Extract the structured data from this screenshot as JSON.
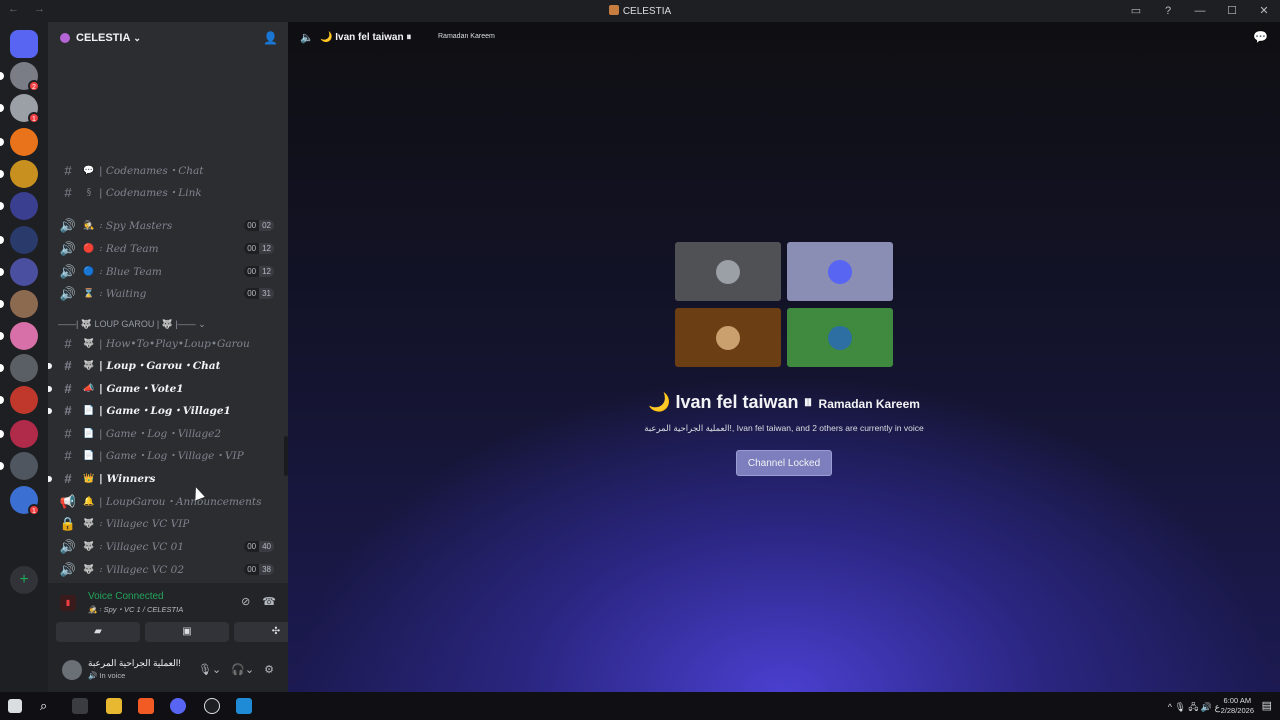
{
  "window": {
    "title": "CELESTIA",
    "controls": [
      "inbox-icon",
      "help-icon",
      "minimize-icon",
      "maximize-icon",
      "close-icon"
    ]
  },
  "guilds": {
    "items": [
      {
        "name": "discord-home",
        "color": "#5865f2"
      },
      {
        "name": "server-1",
        "color": "#7a7d85",
        "badge": "2"
      },
      {
        "name": "server-2",
        "color": "#9aa0a6",
        "badge": "1"
      },
      {
        "name": "server-3",
        "color": "#e8731a"
      },
      {
        "name": "server-4",
        "color": "#c7901f"
      },
      {
        "name": "server-5",
        "color": "#3b3f8f"
      },
      {
        "name": "server-6",
        "color": "#2a3a6a"
      },
      {
        "name": "server-7",
        "color": "#4a4f9f"
      },
      {
        "name": "server-8",
        "color": "#8c6a4f"
      },
      {
        "name": "server-9",
        "color": "#d76fa8"
      },
      {
        "name": "server-10",
        "color": "#5a5f66"
      },
      {
        "name": "server-11",
        "color": "#c0382b"
      },
      {
        "name": "server-12",
        "color": "#b02a4a"
      },
      {
        "name": "server-13",
        "color": "#4f5660"
      },
      {
        "name": "server-14",
        "color": "#3b6fd1",
        "badge": "1"
      }
    ],
    "add_label": "+"
  },
  "server": {
    "name": "CELESTIA"
  },
  "channels": [
    {
      "type": "text",
      "emoji": "💬",
      "name": "Codenames・Chat",
      "bold": false
    },
    {
      "type": "text",
      "emoji": "§",
      "name": "Codenames・Link",
      "bold": false
    },
    {
      "type": "voice",
      "emoji": "🕵",
      "name": "Spy Masters",
      "counts": [
        "00",
        "02"
      ]
    },
    {
      "type": "voice",
      "emoji": "🔴",
      "name": "Red Team",
      "counts": [
        "00",
        "12"
      ]
    },
    {
      "type": "voice",
      "emoji": "🔵",
      "name": "Blue Team",
      "counts": [
        "00",
        "12"
      ]
    },
    {
      "type": "voice",
      "emoji": "⌛",
      "name": "Waiting",
      "counts": [
        "00",
        "31"
      ]
    },
    {
      "type": "text",
      "emoji": "🐺",
      "name": "How•To•Play•Loup•Garou",
      "bold": false
    },
    {
      "type": "text",
      "emoji": "🐺",
      "name": "Loup・Garou・Chat",
      "bold": true,
      "unread": true
    },
    {
      "type": "text",
      "emoji": "📣",
      "name": "Game・Vote1",
      "bold": true,
      "unread": true
    },
    {
      "type": "text",
      "emoji": "📄",
      "name": "Game・Log・Village1",
      "bold": true,
      "unread": true
    },
    {
      "type": "text",
      "emoji": "📄",
      "name": "Game・Log・Village2",
      "bold": false
    },
    {
      "type": "text",
      "emoji": "📄",
      "name": "Game・Log・Village・VIP",
      "bold": false
    },
    {
      "type": "text",
      "emoji": "👑",
      "name": "Winners",
      "bold": true,
      "unread": true
    },
    {
      "type": "announce",
      "emoji": "🔔",
      "name": "LoupGarou・Announcements",
      "bold": false
    },
    {
      "type": "locked",
      "emoji": "🐺",
      "name": "Villagec VC VIP"
    },
    {
      "type": "voice",
      "emoji": "🐺",
      "name": "Villagec VC 01",
      "counts": [
        "00",
        "40"
      ]
    },
    {
      "type": "voice",
      "emoji": "🐺",
      "name": "Villagec VC 02",
      "counts": [
        "00",
        "38"
      ]
    }
  ],
  "category": {
    "label": "——| 🐺 LOUP GAROU | 🐺 |——"
  },
  "voice_panel": {
    "status": "Voice Connected",
    "channel": "🕵 ꞉ Spy・VC 1 / CELESTIA"
  },
  "user": {
    "name": "العملية الجراحية المرعبة!",
    "status": "In voice"
  },
  "voice_channel": {
    "name": "🌙 Ivan fel taiwan ⏸",
    "subtitle": "Ramadan Kareem",
    "big_name": "🌙 Ivan fel taiwan ⏸",
    "big_sub": "Ramadan Kareem",
    "participants_text": "العملية الجراحية المرعبة!, Ivan fel taiwan, and 2 others are currently in voice",
    "button": "Channel Locked",
    "tiles": [
      {
        "color": "#4f5155",
        "avatar": "#9aa0a6"
      },
      {
        "color": "#8a8db4",
        "avatar": "#5865f2"
      },
      {
        "color": "#6b3e14",
        "avatar": "#c9a06e"
      },
      {
        "color": "#3f8a3f",
        "avatar": "#2d6fa3"
      }
    ]
  },
  "taskbar": {
    "time": "6:00 AM",
    "date": "2/28/2026"
  }
}
